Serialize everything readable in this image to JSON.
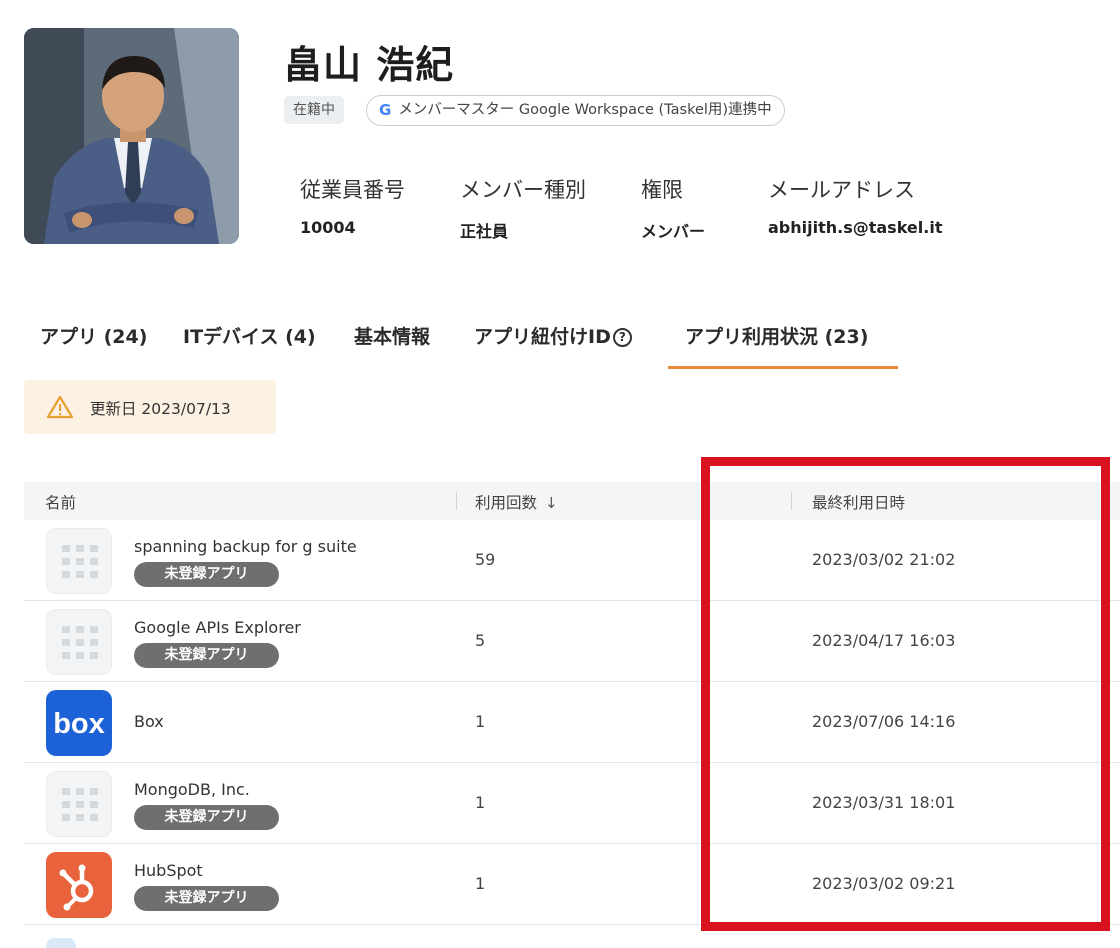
{
  "profile": {
    "name": "畠山 浩紀",
    "status": "在籍中",
    "sync_label": "メンバーマスター Google Workspace (Taskel用)連携中",
    "fields": [
      {
        "label": "従業員番号",
        "value": "10004"
      },
      {
        "label": "メンバー種別",
        "value": "正社員"
      },
      {
        "label": "権限",
        "value": "メンバー"
      },
      {
        "label": "メールアドレス",
        "value": "abhijith.s@taskel.it"
      }
    ]
  },
  "tabs": [
    {
      "label": "アプリ (24)",
      "active": false
    },
    {
      "label": "ITデバイス (4)",
      "active": false
    },
    {
      "label": "基本情報",
      "active": false
    },
    {
      "label": "アプリ紐付けID",
      "active": false
    },
    {
      "label": "アプリ利用状況 (23)",
      "active": true
    }
  ],
  "colors": {
    "tab_accent": "#e8893a",
    "highlight": "#d8121e",
    "badge": "#6f6f6f",
    "notice_bg": "#fdf1e3"
  },
  "notice": {
    "icon": "warning-icon",
    "text": "更新日 2023/07/13"
  },
  "table": {
    "columns": [
      "名前",
      "利用回数",
      "最終利用日時"
    ],
    "sort_icon": "arrow-down-icon",
    "rows": [
      {
        "name": "spanning backup for g suite",
        "badge": "未登録アプリ",
        "icon": "grid-placeholder-icon",
        "count": "59",
        "last_used": "2023/03/02 21:02"
      },
      {
        "name": "Google APIs Explorer",
        "badge": "未登録アプリ",
        "icon": "grid-placeholder-icon",
        "count": "5",
        "last_used": "2023/04/17 16:03"
      },
      {
        "name": "Box",
        "badge": "",
        "icon": "box-logo-icon",
        "count": "1",
        "last_used": "2023/07/06 14:16"
      },
      {
        "name": "MongoDB, Inc.",
        "badge": "未登録アプリ",
        "icon": "grid-placeholder-icon",
        "count": "1",
        "last_used": "2023/03/31 18:01"
      },
      {
        "name": "HubSpot",
        "badge": "未登録アプリ",
        "icon": "hubspot-logo-icon",
        "count": "1",
        "last_used": "2023/03/02 09:21"
      }
    ]
  },
  "logo_text": {
    "box": "box"
  }
}
